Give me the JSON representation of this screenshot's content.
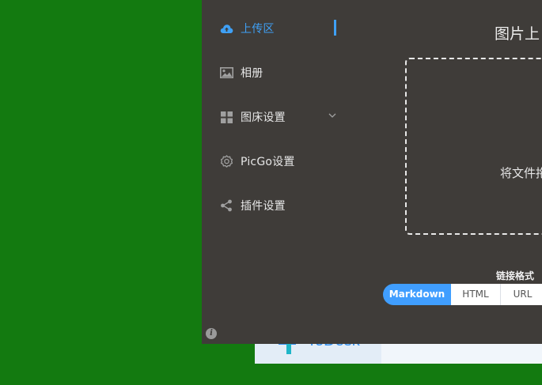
{
  "background_app": {
    "logo_text": "ToDesk"
  },
  "sidebar": {
    "items": [
      {
        "label": "上传区",
        "icon": "cloud-upload-icon",
        "active": true
      },
      {
        "label": "相册",
        "icon": "image-icon"
      },
      {
        "label": "图床设置",
        "icon": "grid-icon",
        "has_submenu": true
      },
      {
        "label": "PicGo设置",
        "icon": "gear-icon"
      },
      {
        "label": "插件设置",
        "icon": "share-icon"
      }
    ],
    "info_glyph": "i"
  },
  "main": {
    "title": "图片上",
    "drop_text": "将文件拖",
    "link_format_label": "链接格式",
    "formats": [
      "Markdown",
      "HTML",
      "URL"
    ],
    "selected_format": "Markdown"
  },
  "colors": {
    "accent": "#409eff",
    "active_nav": "#3fa0f5",
    "window_bg": "#3f3c39",
    "desktop": "#137a10"
  }
}
